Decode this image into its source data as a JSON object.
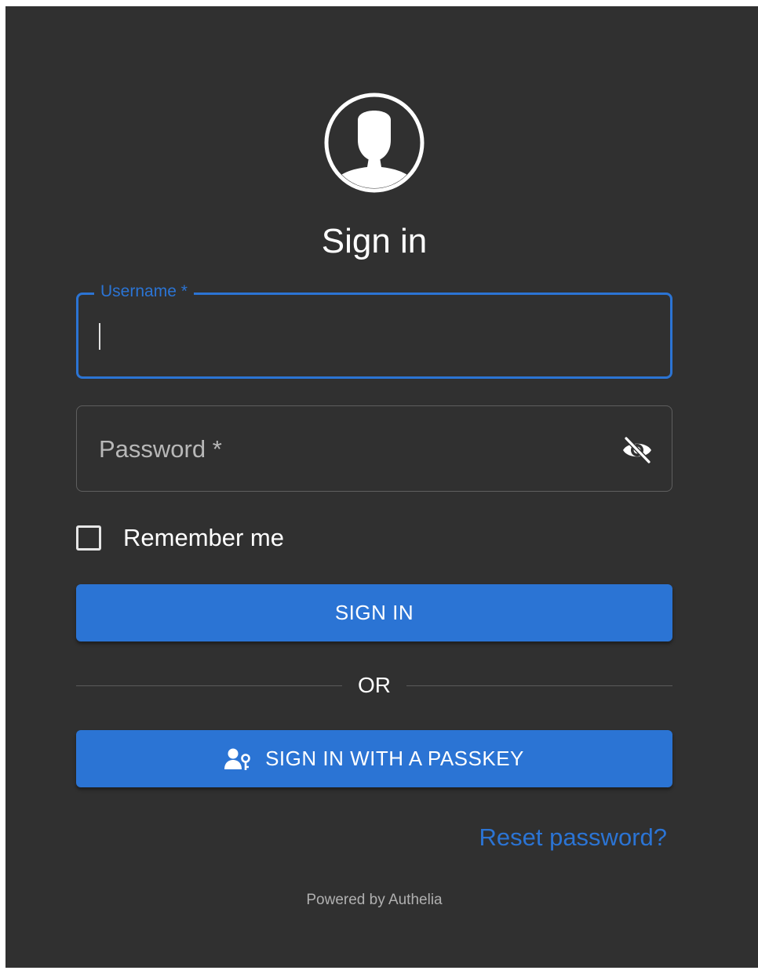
{
  "page": {
    "title": "Sign in",
    "footer": "Powered by Authelia"
  },
  "form": {
    "username": {
      "label": "Username *",
      "value": ""
    },
    "password": {
      "placeholder": "Password *",
      "value": "",
      "visibility_icon": "eye-off-icon"
    },
    "remember_me": {
      "label": "Remember me",
      "checked": false
    },
    "sign_in_button": "SIGN IN",
    "divider_text": "OR",
    "passkey_button": "SIGN IN WITH A PASSKEY",
    "passkey_icon": "user-key-icon",
    "reset_link": "Reset password?"
  },
  "colors": {
    "background": "#303030",
    "accent": "#2b74d4",
    "text": "#ffffff",
    "muted": "#b0b0b0"
  },
  "icons": {
    "avatar": "user-avatar-icon"
  }
}
